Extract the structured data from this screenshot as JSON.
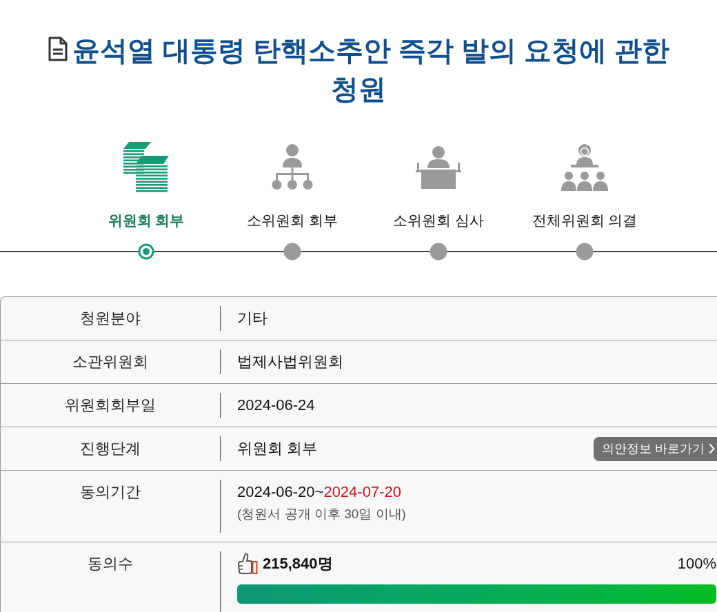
{
  "title": {
    "text": "윤석열 대통령 탄핵소추안 즉각 발의 요청에 관한 청원"
  },
  "steps": [
    {
      "label": "위원회 회부",
      "selected": true
    },
    {
      "label": "소위원회 회부",
      "selected": false
    },
    {
      "label": "소위원회 심사",
      "selected": false
    },
    {
      "label": "전체위원회 의결",
      "selected": false
    }
  ],
  "details": [
    {
      "kind": "text",
      "label": "청원분야",
      "value": "기타"
    },
    {
      "kind": "text",
      "label": "소관위원회",
      "value": "법제사법위원회"
    },
    {
      "kind": "text",
      "label": "위원회회부일",
      "value": "2024-06-24"
    },
    {
      "kind": "stage",
      "label": "진행단계",
      "value": "위원회 회부",
      "button": "의안정보 바로가기"
    },
    {
      "kind": "period",
      "label": "동의기간",
      "start": "2024-06-20~",
      "end": "2024-07-20",
      "note": "(청원서 공개 이후 30일 이내)"
    },
    {
      "kind": "count",
      "label": "동의수",
      "count": "215,840명",
      "percent": "100%",
      "level": 1
    }
  ]
}
